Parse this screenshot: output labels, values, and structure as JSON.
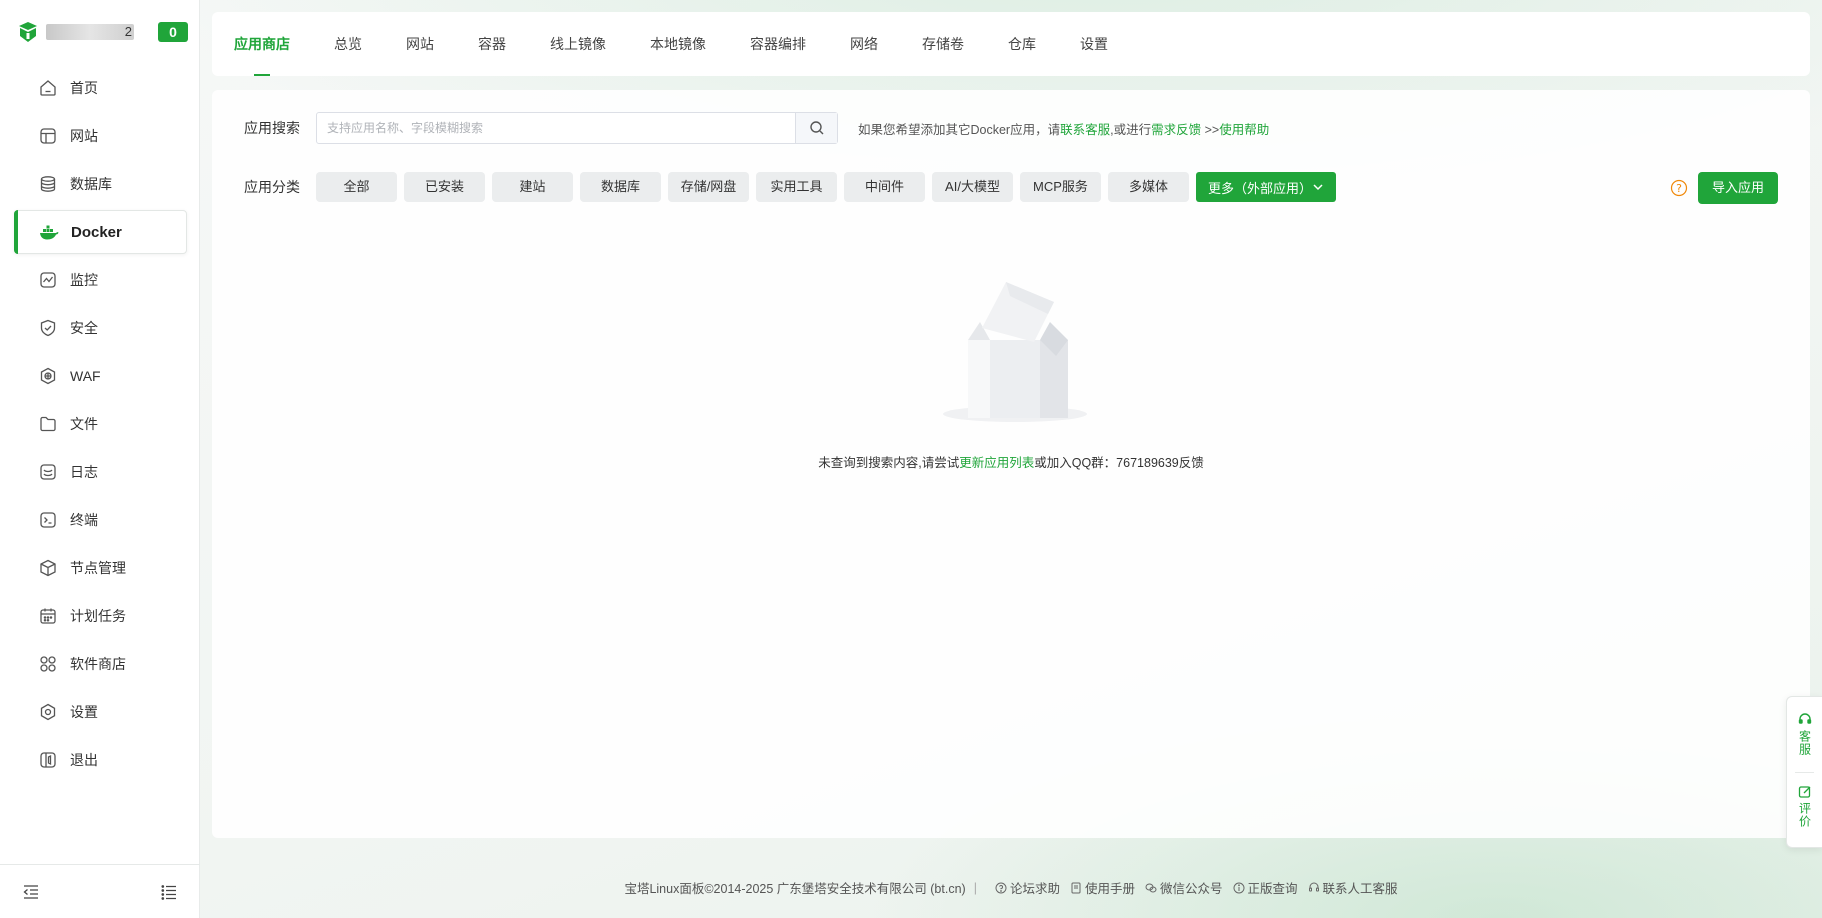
{
  "brand": {
    "name_suffix": "2",
    "badge": "0"
  },
  "sidebar": {
    "items": [
      {
        "label": "首页",
        "icon": "home-icon"
      },
      {
        "label": "网站",
        "icon": "website-icon"
      },
      {
        "label": "数据库",
        "icon": "database-icon"
      },
      {
        "label": "Docker",
        "icon": "docker-icon"
      },
      {
        "label": "监控",
        "icon": "monitor-icon"
      },
      {
        "label": "安全",
        "icon": "shield-icon"
      },
      {
        "label": "WAF",
        "icon": "waf-icon"
      },
      {
        "label": "文件",
        "icon": "folder-icon"
      },
      {
        "label": "日志",
        "icon": "log-icon"
      },
      {
        "label": "终端",
        "icon": "terminal-icon"
      },
      {
        "label": "节点管理",
        "icon": "node-icon"
      },
      {
        "label": "计划任务",
        "icon": "calendar-icon"
      },
      {
        "label": "软件商店",
        "icon": "apps-icon"
      },
      {
        "label": "设置",
        "icon": "gear-icon"
      },
      {
        "label": "退出",
        "icon": "logout-icon"
      }
    ],
    "active": "Docker"
  },
  "tabs": [
    "应用商店",
    "总览",
    "网站",
    "容器",
    "线上镜像",
    "本地镜像",
    "容器编排",
    "网络",
    "存储卷",
    "仓库",
    "设置"
  ],
  "search": {
    "label": "应用搜索",
    "placeholder": "支持应用名称、字段模糊搜索",
    "value": "",
    "hint_prefix": "如果您希望添加其它Docker应用，请",
    "hint_link1": "联系客服",
    "hint_mid": ",或进行",
    "hint_link2": "需求反馈",
    "hint_sep": " >>",
    "hint_link3": "使用帮助"
  },
  "categories": {
    "label": "应用分类",
    "items": [
      "全部",
      "已安装",
      "建站",
      "数据库",
      "存储/网盘",
      "实用工具",
      "中间件",
      "AI/大模型",
      "MCP服务",
      "多媒体"
    ],
    "more": "更多（外部应用）"
  },
  "import_button": "导入应用",
  "empty": {
    "prefix": "未查询到搜索内容,请尝试",
    "link": "更新应用列表",
    "suffix": "或加入QQ群：767189639反馈"
  },
  "footer": {
    "copyright": "宝塔Linux面板©2014-2025 广东堡塔安全技术有限公司 (bt.cn)",
    "links": [
      "论坛求助",
      "使用手册",
      "微信公众号",
      "正版查询",
      "联系人工客服"
    ]
  },
  "float": {
    "service": "客服",
    "review": "评价"
  },
  "colors": {
    "accent": "#20a53a"
  }
}
